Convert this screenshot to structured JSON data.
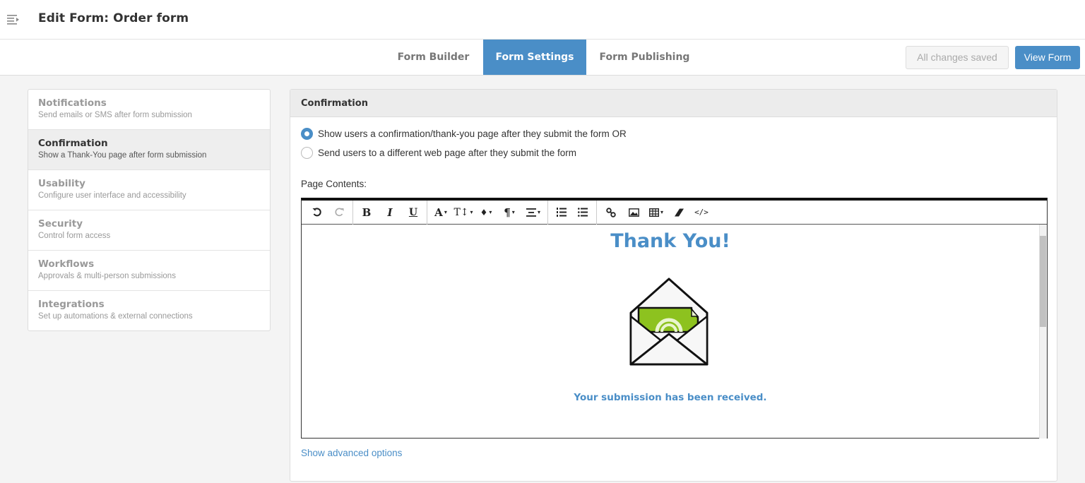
{
  "header": {
    "title": "Edit Form: Order form",
    "menu_icon": "sidebar-toggle-icon"
  },
  "tabs": [
    {
      "label": "Form Builder",
      "active": false
    },
    {
      "label": "Form Settings",
      "active": true
    },
    {
      "label": "Form Publishing",
      "active": false
    }
  ],
  "actions": {
    "saved_label": "All changes saved",
    "view_label": "View Form"
  },
  "sidebar": {
    "items": [
      {
        "title": "Notifications",
        "desc": "Send emails or SMS after form submission",
        "active": false
      },
      {
        "title": "Confirmation",
        "desc": "Show a Thank-You page after form submission",
        "active": true
      },
      {
        "title": "Usability",
        "desc": "Configure user interface and accessibility",
        "active": false
      },
      {
        "title": "Security",
        "desc": "Control form access",
        "active": false
      },
      {
        "title": "Workflows",
        "desc": "Approvals & multi-person submissions",
        "active": false
      },
      {
        "title": "Integrations",
        "desc": "Set up automations & external connections",
        "active": false
      }
    ]
  },
  "panel": {
    "title": "Confirmation",
    "options": [
      {
        "label": "Show users a confirmation/thank-you page after they submit the form OR",
        "selected": true
      },
      {
        "label": "Send users to a different web page after they submit the form",
        "selected": false
      }
    ],
    "page_contents_label": "Page Contents:",
    "advanced_link": "Show advanced options"
  },
  "editor": {
    "toolbar": [
      "undo-icon",
      "redo-icon",
      "bold-icon",
      "italic-icon",
      "underline-icon",
      "font-color-icon",
      "font-size-icon",
      "highlight-icon",
      "paragraph-icon",
      "align-icon",
      "ordered-list-icon",
      "unordered-list-icon",
      "link-icon",
      "image-icon",
      "table-icon",
      "clear-format-icon",
      "code-view-icon"
    ],
    "heading": "Thank You!",
    "message": "Your submission has been received."
  },
  "colors": {
    "accent": "#4a8ec7",
    "envelope_paper": "#8dc21f"
  }
}
